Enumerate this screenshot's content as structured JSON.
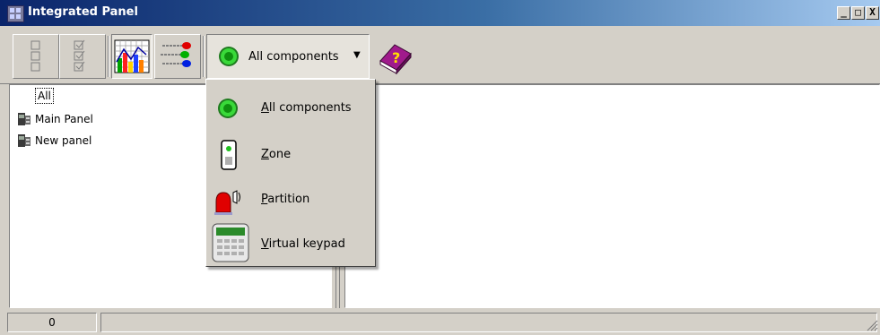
{
  "window": {
    "title": "Integrated Panel",
    "minimize": "_",
    "maximize": "□",
    "close": "X"
  },
  "toolbar": {
    "filter_dropdown": {
      "selected": "All components",
      "arrow": "▼"
    },
    "help_icon_mark": "?"
  },
  "tree": {
    "items": [
      {
        "label": "All"
      },
      {
        "label": "Main Panel"
      },
      {
        "label": "New panel"
      }
    ]
  },
  "menu": {
    "items": [
      {
        "label": "All components",
        "mnemonic": "A",
        "rest": "ll components",
        "icon": "green-dot-icon"
      },
      {
        "label": "Zone",
        "mnemonic": "Z",
        "rest": "one",
        "icon": "zone-icon"
      },
      {
        "label": "Partition",
        "mnemonic": "P",
        "rest": "artition",
        "icon": "siren-icon"
      },
      {
        "label": "Virtual keypad",
        "mnemonic": "V",
        "rest": "irtual keypad",
        "icon": "keypad-icon"
      }
    ]
  },
  "statusbar": {
    "count": "0"
  },
  "colors": {
    "title_start": "#0a246a",
    "title_end": "#a6caf0",
    "face": "#d4d0c8"
  }
}
